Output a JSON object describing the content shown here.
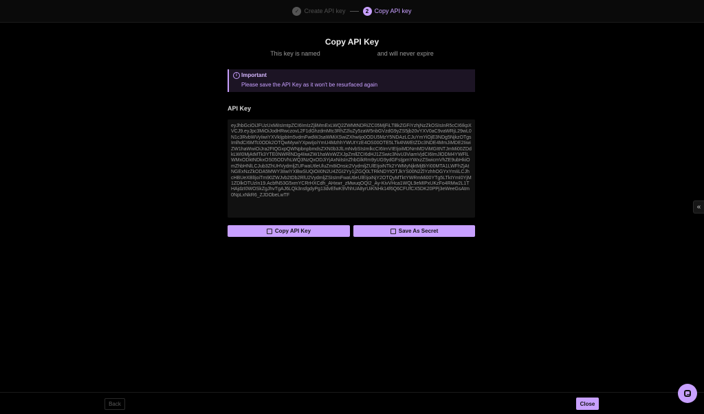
{
  "stepper": {
    "steps": [
      {
        "number": "✓",
        "label": "Create API key",
        "state": "done"
      },
      {
        "number": "2",
        "label": "Copy API key",
        "state": "active"
      }
    ]
  },
  "dialog": {
    "title": "Copy API Key",
    "subtitle_prefix": "This key is named",
    "subtitle_suffix": "and will never expire",
    "alert": {
      "icon": "info-icon",
      "title": "Important",
      "body": "Please save the API Key as it won't be resurfaced again"
    },
    "api_key_label": "API Key",
    "api_key_value": "eyJhbGciOiJFUzUxMiIsImtpZCI6ImIzZjliMmExLWQ2ZWMtNDRiZC05MjFiLTBkZGFiYzhjNzZkOSIsInR5cCI6IkpXVCJ9.eyJpc3MiOiJodHRwczovL2F1dGhzdmMtc3RhZ2luZy5zaW5nbGVzdG9yZS5jb20vYXV0aC9vaWRjL29wL0N1c3RvbWVyIiwiYXVkIjpbIm5vdmFwdWJsaWMiXSwiZXhwIjo0ODU5MzY5NDAzLCJuYmYiOjE3NDg5NjkzOTgsImlhdCI6MTc0ODk2OTQwMywiYXpwIjoiYmU4MzhhYWUtYzE4OS00OTE5LTk4NWEtZDc3NDE4MmJiMDE2IiwiZW1haWwiOiJra2FtQGxpQWNpbnpbmdsZXN0b3JlLmNvbSIsImlkcCI6ImVIEIjoiMDNmMDViMGItNTJmMi00ZDdkLWI0MjAtMTk3YTE0NWRlNDg4IiwiZW1haWxWZXJpZmllZCI6dHJ1ZSwic3NvU3ViamVjdCI6ImJlODM4YWFlLWMxODktNDkxOS05ODVhLWQ3NzQxODJiYjAxNiIsInZhbGlkRm9yUG9ydGFsIjpmYWxzZSwicmVhZE9ubHkiOmZhbHNlLCJub3ZhUHVydmljZUFwaUtleUluZm8iOnsic2VydmljZUlEIjoiNTk2YWMyNjktMjBiYi00MTA1LWFhZjAtNGExNzZkODA5MWY3IiwiYXBwSUQiOiI0N2U4ZGI2Yy1jZGQ0LTRkNDYtOTJkYS00N2ZlYzhhOGYxYmIiLCJhcHBUeXBlIjoiTm90ZWJvb2tDb2RlU2VydmljZSIsImFwaUtleUlEIjoiNjY2OTQyMTktYWRmMi00YTg5LTktYmI0YjM1ZDlkOTUzIn19.AcbfN53G5xmYCRrHXCdh_AHxwr_zMwuqOQI2_Ay-KivVHca1WQL9eMIPxUKzFo4RMw2L1THAjdzI0WOSkZgJhvTgAJ6LQk3nsfgdyPg13dvEfwK9VhhUA8yrUiKNHk14f6Q6CFUfCX5DK20PPj3eWeeGsAtm0NpLxNkR6_ZJDObeLwTF",
    "copy_button": "Copy API Key",
    "secret_button": "Save As Secret"
  },
  "footer": {
    "back_button": "Back",
    "close_button": "Close"
  },
  "side_handle": "«",
  "colors": {
    "accent": "#c8a0ff",
    "background": "#000000",
    "alert_background": "#1c1424"
  }
}
